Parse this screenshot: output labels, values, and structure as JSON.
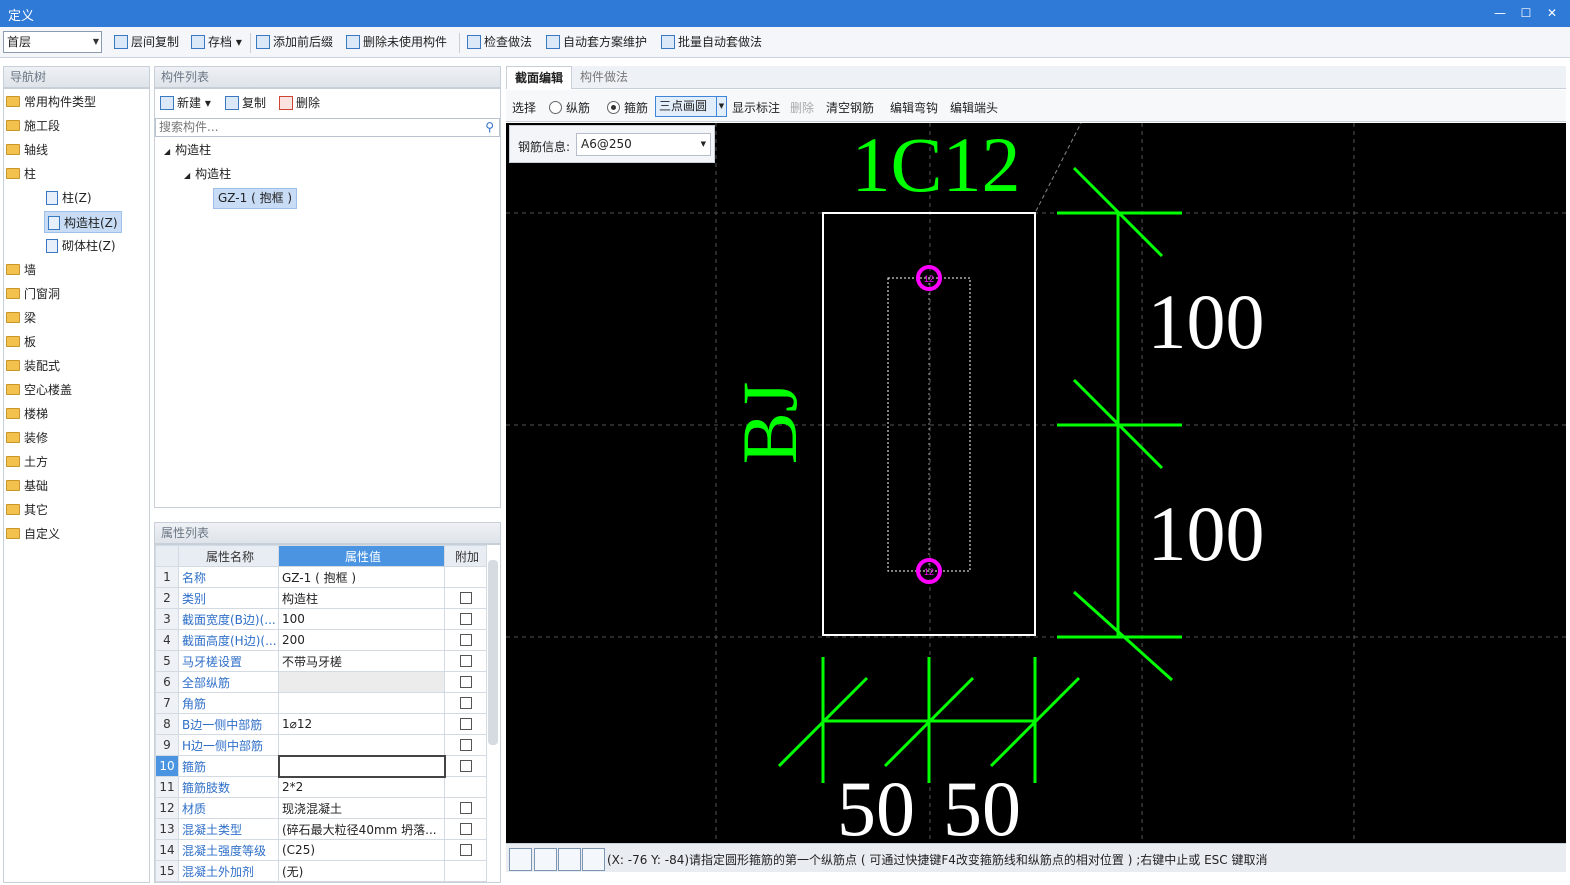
{
  "window": {
    "title": "定义"
  },
  "toolbar": {
    "floor": "首层",
    "items": [
      "层间复制",
      "存档",
      "添加前后缀",
      "删除未使用构件",
      "检查做法",
      "自动套方案维护",
      "批量自动套做法"
    ]
  },
  "nav": {
    "header": "导航树",
    "items": [
      "常用构件类型",
      "施工段",
      "轴线",
      "柱",
      "柱(Z)",
      "构造柱(Z)",
      "砌体柱(Z)",
      "墙",
      "门窗洞",
      "梁",
      "板",
      "装配式",
      "空心楼盖",
      "楼梯",
      "装修",
      "土方",
      "基础",
      "其它",
      "自定义"
    ]
  },
  "components": {
    "header": "构件列表",
    "new_label": "新建",
    "copy_label": "复制",
    "delete_label": "删除",
    "search_placeholder": "搜索构件...",
    "tree": [
      "构造柱",
      "构造柱",
      "GZ-1 ( 抱框 )"
    ]
  },
  "properties": {
    "header": "属性列表",
    "columns": [
      "属性名称",
      "属性值",
      "附加"
    ],
    "rows": [
      {
        "num": "1",
        "name": "名称",
        "value": "GZ-1 ( 抱框 )",
        "check": false
      },
      {
        "num": "2",
        "name": "类别",
        "value": "构造柱",
        "check": true
      },
      {
        "num": "3",
        "name": "截面宽度(B边)(...",
        "value": "100",
        "check": true
      },
      {
        "num": "4",
        "name": "截面高度(H边)(...",
        "value": "200",
        "check": true
      },
      {
        "num": "5",
        "name": "马牙槎设置",
        "value": "不带马牙槎",
        "check": true
      },
      {
        "num": "6",
        "name": "全部纵筋",
        "value": "",
        "check": true
      },
      {
        "num": "7",
        "name": "角筋",
        "value": "",
        "check": true
      },
      {
        "num": "8",
        "name": "B边一侧中部筋",
        "value": "1⌀12",
        "check": true
      },
      {
        "num": "9",
        "name": "H边一侧中部筋",
        "value": "",
        "check": true
      },
      {
        "num": "10",
        "name": "箍筋",
        "value": "",
        "check": true
      },
      {
        "num": "11",
        "name": "箍筋肢数",
        "value": "2*2",
        "check": false
      },
      {
        "num": "12",
        "name": "材质",
        "value": "现浇混凝土",
        "check": true
      },
      {
        "num": "13",
        "name": "混凝土类型",
        "value": "(碎石最大粒径40mm 坍落...",
        "check": true
      },
      {
        "num": "14",
        "name": "混凝土强度等级",
        "value": "(C25)",
        "check": true
      },
      {
        "num": "15",
        "name": "混凝土外加剂",
        "value": "(无)",
        "check": false
      }
    ]
  },
  "editor": {
    "tabs": [
      "截面编辑",
      "构件做法"
    ],
    "select_label": "选择",
    "long_rebar_label": "纵筋",
    "stirrup_label": "箍筋",
    "mode": "三点画圆",
    "show_label": "显示标注",
    "delete_label": "删除",
    "clear_label": "清空钢筋",
    "edit_hook_label": "编辑弯钩",
    "edit_end_label": "编辑端头",
    "rebar_info_label": "钢筋信息:",
    "rebar_info_value": "A6@250"
  },
  "drawing": {
    "rebar_label": "1C12",
    "side_label": "BJ",
    "dim_right_top": "100",
    "dim_right_bottom": "100",
    "dim_bottom_left": "50",
    "dim_bottom_right": "50",
    "bar_mark": "12",
    "colors": {
      "dim": "#00ff00",
      "bar": "#ff00ff",
      "outline": "#ffffff",
      "bg": "#000000"
    }
  },
  "status": {
    "message": "(X: -76 Y: -84)请指定圆形箍筋的第一个纵筋点 ( 可通过快捷键F4改变箍筋线和纵筋点的相对位置 ) ;右键中止或 ESC 键取消"
  }
}
